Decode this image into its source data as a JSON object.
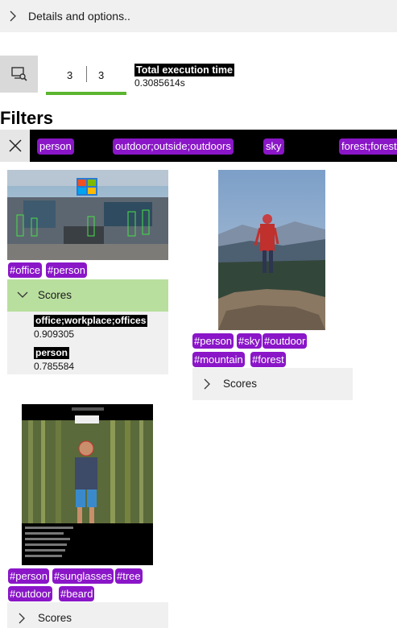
{
  "details": {
    "label": "Details and options.."
  },
  "stats": {
    "count_a": "3",
    "count_b": "3",
    "exec_title": "Total execution time",
    "exec_value": "0.3085614s",
    "progress": 1.0
  },
  "filters": {
    "heading": "Filters",
    "chips": [
      "person",
      "outdoor;outside;outdoors",
      "sky",
      "forest;forest"
    ]
  },
  "images": [
    {
      "tags": [
        "#office",
        "#person"
      ],
      "scores_label": "Scores",
      "expanded": true,
      "scores": [
        {
          "name": "office;workplace;offices",
          "value": "0.909305"
        },
        {
          "name": "person",
          "value": "0.785584"
        }
      ]
    },
    {
      "tags": [
        "#person",
        "#sky",
        "#outdoor",
        "#mountain",
        "#forest"
      ],
      "scores_label": "Scores",
      "expanded": false
    },
    {
      "tags": [
        "#person",
        "#sunglasses",
        "#tree",
        "#outdoor",
        "#beard"
      ],
      "scores_label": "Scores",
      "expanded": false
    }
  ],
  "colors": {
    "accent_green": "#5bb52f",
    "expanded_header": "#b9df9f",
    "tag_purple": "#8a16c8"
  }
}
